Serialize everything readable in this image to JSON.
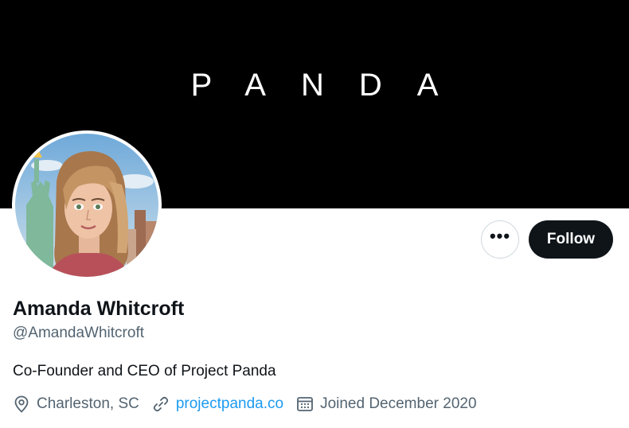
{
  "banner": {
    "text": "PANDA"
  },
  "actions": {
    "more_label": "•••",
    "follow_label": "Follow"
  },
  "profile": {
    "name": "Amanda Whitcroft",
    "handle": "@AmandaWhitcroft",
    "bio": "Co-Founder and CEO of Project Panda",
    "location": "Charleston, SC",
    "website": "projectpanda.co",
    "joined": "Joined December 2020"
  },
  "icons": {
    "location": "location-pin-icon",
    "link": "link-icon",
    "calendar": "calendar-icon",
    "more": "more-dots-icon"
  },
  "colors": {
    "banner": "#000000",
    "follow_bg": "#0f1419",
    "link": "#1d9bf0",
    "secondary_text": "#536471"
  }
}
